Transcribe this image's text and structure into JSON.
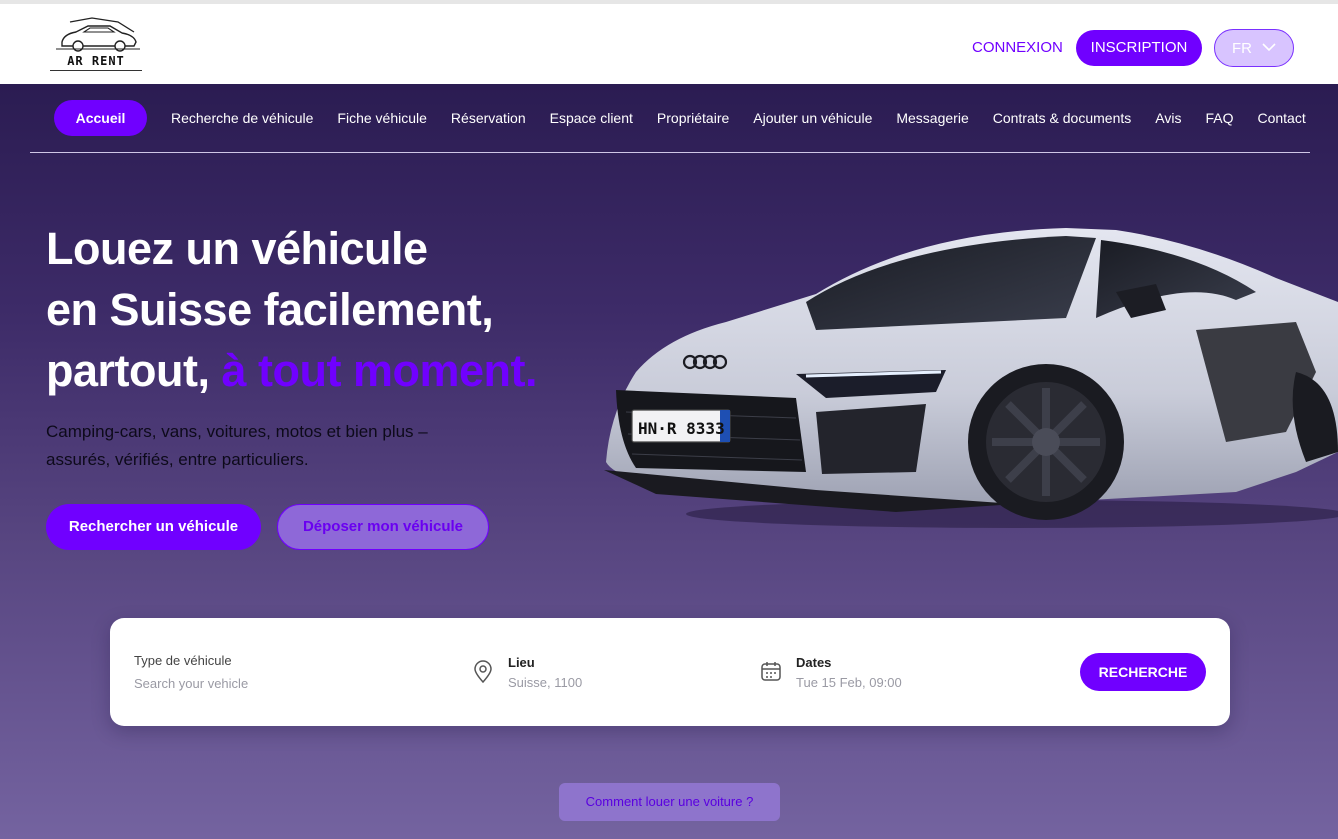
{
  "brand": {
    "logo_text": "AR RENT"
  },
  "header": {
    "login_label": "CONNEXION",
    "signup_label": "INSCRIPTION",
    "language": "FR"
  },
  "nav": {
    "items": [
      {
        "label": "Accueil"
      },
      {
        "label": "Recherche de véhicule"
      },
      {
        "label": "Fiche véhicule"
      },
      {
        "label": "Réservation"
      },
      {
        "label": "Espace client"
      },
      {
        "label": "Propriétaire"
      },
      {
        "label": "Ajouter un véhicule"
      },
      {
        "label": "Messagerie"
      },
      {
        "label": "Contrats & documents"
      },
      {
        "label": "Avis"
      },
      {
        "label": "FAQ"
      },
      {
        "label": "Contact"
      }
    ]
  },
  "hero": {
    "line1": "Louez un véhicule",
    "line2": "en Suisse facilement,",
    "line3_plain": "partout, ",
    "line3_accent": "à tout moment.",
    "subline_1": "Camping-cars, vans, voitures, motos et bien plus –",
    "subline_2": "assurés, vérifiés, entre particuliers.",
    "cta_primary": "Rechercher un véhicule",
    "cta_secondary": "Déposer mon véhicule",
    "plate_text": "HN·R 8333"
  },
  "search": {
    "type_label": "Type de véhicule",
    "type_placeholder": "Search your vehicle",
    "location_label": "Lieu",
    "location_value": "Suisse, 1100",
    "dates_label": "Dates",
    "dates_value": "Tue 15 Feb, 09:00",
    "button_label": "RECHERCHE"
  },
  "howto_label": "Comment louer une voiture ?",
  "colors": {
    "accent": "#7000ff",
    "hero_top": "#2b1c52",
    "hero_bottom": "#7463a0"
  }
}
